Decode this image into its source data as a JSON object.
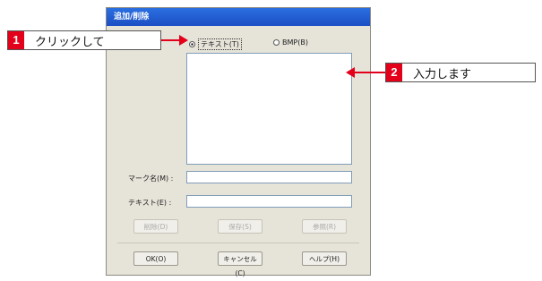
{
  "dialog": {
    "title": "追加/削除",
    "radio_text": "テキスト(T)",
    "radio_bmp": "BMP(B)",
    "mark_name_label": "マーク名(M) :",
    "text_label": "テキスト(E) :",
    "buttons_top": [
      "削除(D)",
      "保存(S)",
      "参照(R)"
    ],
    "buttons_bottom": [
      "OK(O)",
      "キャンセル(C)",
      "ヘルプ(H)"
    ]
  },
  "callouts": [
    {
      "num": "1",
      "text": "クリックして"
    },
    {
      "num": "2",
      "text": "入力します"
    }
  ],
  "colors": {
    "accent": "#e2001a",
    "title": "#1c4fc4"
  }
}
